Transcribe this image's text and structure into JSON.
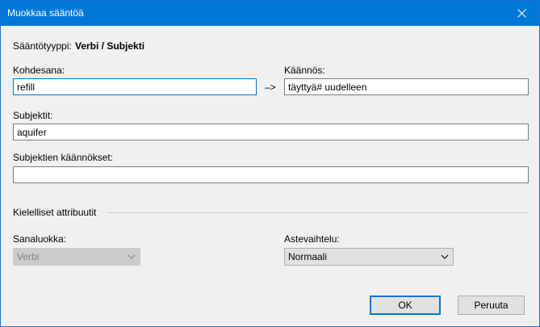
{
  "window": {
    "title": "Muokkaa sääntöä"
  },
  "rule_type": {
    "label": "Sääntötyyppi:",
    "value": "Verbi / Subjekti"
  },
  "source_word": {
    "label": "Kohdesana:",
    "value": "refill"
  },
  "arrow": "–>",
  "translation": {
    "label": "Käännös:",
    "value": "täyttyä# uudelleen"
  },
  "subjects": {
    "label": "Subjektit:",
    "value": "aquifer"
  },
  "subject_translations": {
    "label": "Subjektien käännökset:",
    "value": ""
  },
  "linguistic_attributes": {
    "heading": "Kielelliset attribuutit",
    "word_class": {
      "label": "Sanaluokka:",
      "selected": "Verbi",
      "disabled": true
    },
    "gradation": {
      "label": "Astevaihtelu:",
      "selected": "Normaali"
    }
  },
  "buttons": {
    "ok": "OK",
    "cancel": "Peruuta"
  },
  "icons": {
    "close": "close-icon",
    "dropdown": "chevron-down-icon"
  },
  "colors": {
    "titlebar": "#0078d7",
    "focus_border": "#0078d7"
  }
}
